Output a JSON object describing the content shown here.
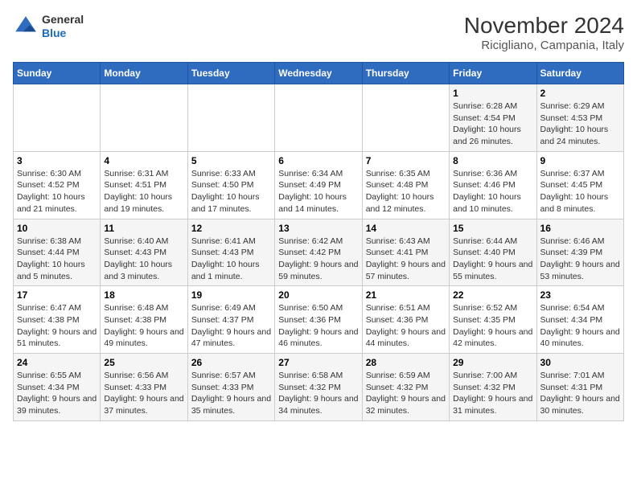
{
  "header": {
    "logo": {
      "line1": "General",
      "line2": "Blue"
    },
    "title": "November 2024",
    "subtitle": "Ricigliano, Campania, Italy"
  },
  "calendar": {
    "weekdays": [
      "Sunday",
      "Monday",
      "Tuesday",
      "Wednesday",
      "Thursday",
      "Friday",
      "Saturday"
    ],
    "weeks": [
      [
        {
          "day": "",
          "info": ""
        },
        {
          "day": "",
          "info": ""
        },
        {
          "day": "",
          "info": ""
        },
        {
          "day": "",
          "info": ""
        },
        {
          "day": "",
          "info": ""
        },
        {
          "day": "1",
          "info": "Sunrise: 6:28 AM\nSunset: 4:54 PM\nDaylight: 10 hours and 26 minutes."
        },
        {
          "day": "2",
          "info": "Sunrise: 6:29 AM\nSunset: 4:53 PM\nDaylight: 10 hours and 24 minutes."
        }
      ],
      [
        {
          "day": "3",
          "info": "Sunrise: 6:30 AM\nSunset: 4:52 PM\nDaylight: 10 hours and 21 minutes."
        },
        {
          "day": "4",
          "info": "Sunrise: 6:31 AM\nSunset: 4:51 PM\nDaylight: 10 hours and 19 minutes."
        },
        {
          "day": "5",
          "info": "Sunrise: 6:33 AM\nSunset: 4:50 PM\nDaylight: 10 hours and 17 minutes."
        },
        {
          "day": "6",
          "info": "Sunrise: 6:34 AM\nSunset: 4:49 PM\nDaylight: 10 hours and 14 minutes."
        },
        {
          "day": "7",
          "info": "Sunrise: 6:35 AM\nSunset: 4:48 PM\nDaylight: 10 hours and 12 minutes."
        },
        {
          "day": "8",
          "info": "Sunrise: 6:36 AM\nSunset: 4:46 PM\nDaylight: 10 hours and 10 minutes."
        },
        {
          "day": "9",
          "info": "Sunrise: 6:37 AM\nSunset: 4:45 PM\nDaylight: 10 hours and 8 minutes."
        }
      ],
      [
        {
          "day": "10",
          "info": "Sunrise: 6:38 AM\nSunset: 4:44 PM\nDaylight: 10 hours and 5 minutes."
        },
        {
          "day": "11",
          "info": "Sunrise: 6:40 AM\nSunset: 4:43 PM\nDaylight: 10 hours and 3 minutes."
        },
        {
          "day": "12",
          "info": "Sunrise: 6:41 AM\nSunset: 4:43 PM\nDaylight: 10 hours and 1 minute."
        },
        {
          "day": "13",
          "info": "Sunrise: 6:42 AM\nSunset: 4:42 PM\nDaylight: 9 hours and 59 minutes."
        },
        {
          "day": "14",
          "info": "Sunrise: 6:43 AM\nSunset: 4:41 PM\nDaylight: 9 hours and 57 minutes."
        },
        {
          "day": "15",
          "info": "Sunrise: 6:44 AM\nSunset: 4:40 PM\nDaylight: 9 hours and 55 minutes."
        },
        {
          "day": "16",
          "info": "Sunrise: 6:46 AM\nSunset: 4:39 PM\nDaylight: 9 hours and 53 minutes."
        }
      ],
      [
        {
          "day": "17",
          "info": "Sunrise: 6:47 AM\nSunset: 4:38 PM\nDaylight: 9 hours and 51 minutes."
        },
        {
          "day": "18",
          "info": "Sunrise: 6:48 AM\nSunset: 4:38 PM\nDaylight: 9 hours and 49 minutes."
        },
        {
          "day": "19",
          "info": "Sunrise: 6:49 AM\nSunset: 4:37 PM\nDaylight: 9 hours and 47 minutes."
        },
        {
          "day": "20",
          "info": "Sunrise: 6:50 AM\nSunset: 4:36 PM\nDaylight: 9 hours and 46 minutes."
        },
        {
          "day": "21",
          "info": "Sunrise: 6:51 AM\nSunset: 4:36 PM\nDaylight: 9 hours and 44 minutes."
        },
        {
          "day": "22",
          "info": "Sunrise: 6:52 AM\nSunset: 4:35 PM\nDaylight: 9 hours and 42 minutes."
        },
        {
          "day": "23",
          "info": "Sunrise: 6:54 AM\nSunset: 4:34 PM\nDaylight: 9 hours and 40 minutes."
        }
      ],
      [
        {
          "day": "24",
          "info": "Sunrise: 6:55 AM\nSunset: 4:34 PM\nDaylight: 9 hours and 39 minutes."
        },
        {
          "day": "25",
          "info": "Sunrise: 6:56 AM\nSunset: 4:33 PM\nDaylight: 9 hours and 37 minutes."
        },
        {
          "day": "26",
          "info": "Sunrise: 6:57 AM\nSunset: 4:33 PM\nDaylight: 9 hours and 35 minutes."
        },
        {
          "day": "27",
          "info": "Sunrise: 6:58 AM\nSunset: 4:32 PM\nDaylight: 9 hours and 34 minutes."
        },
        {
          "day": "28",
          "info": "Sunrise: 6:59 AM\nSunset: 4:32 PM\nDaylight: 9 hours and 32 minutes."
        },
        {
          "day": "29",
          "info": "Sunrise: 7:00 AM\nSunset: 4:32 PM\nDaylight: 9 hours and 31 minutes."
        },
        {
          "day": "30",
          "info": "Sunrise: 7:01 AM\nSunset: 4:31 PM\nDaylight: 9 hours and 30 minutes."
        }
      ]
    ]
  }
}
